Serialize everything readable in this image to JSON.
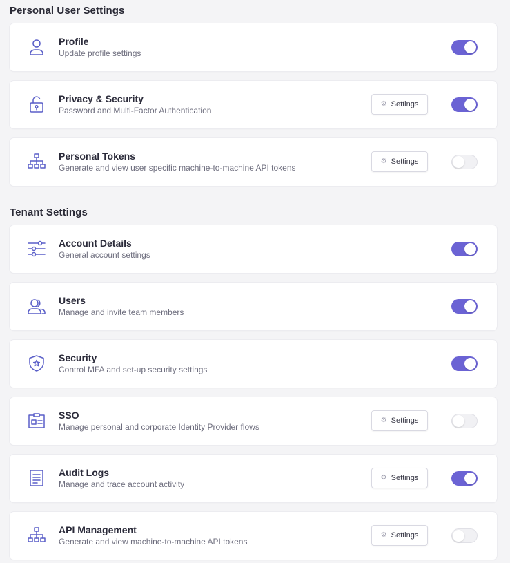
{
  "sections": [
    {
      "title": "Personal User Settings",
      "items": [
        {
          "id": "profile",
          "title": "Profile",
          "description": "Update profile settings",
          "icon": "user-icon",
          "has_settings": false,
          "enabled": true
        },
        {
          "id": "privacy-security",
          "title": "Privacy & Security",
          "description": "Password and Multi-Factor Authentication",
          "icon": "unlock-icon",
          "has_settings": true,
          "enabled": true
        },
        {
          "id": "personal-tokens",
          "title": "Personal Tokens",
          "description": "Generate and view user specific machine-to-machine API tokens",
          "icon": "network-icon",
          "has_settings": true,
          "enabled": false
        }
      ]
    },
    {
      "title": "Tenant Settings",
      "items": [
        {
          "id": "account-details",
          "title": "Account Details",
          "description": "General account settings",
          "icon": "sliders-icon",
          "has_settings": false,
          "enabled": true
        },
        {
          "id": "users",
          "title": "Users",
          "description": "Manage and invite team members",
          "icon": "users-icon",
          "has_settings": false,
          "enabled": true
        },
        {
          "id": "security",
          "title": "Security",
          "description": "Control MFA and set-up security settings",
          "icon": "shield-star-icon",
          "has_settings": false,
          "enabled": true
        },
        {
          "id": "sso",
          "title": "SSO",
          "description": "Manage personal and corporate Identity Provider flows",
          "icon": "id-card-icon",
          "has_settings": true,
          "enabled": false
        },
        {
          "id": "audit-logs",
          "title": "Audit Logs",
          "description": "Manage and trace account activity",
          "icon": "document-icon",
          "has_settings": true,
          "enabled": true
        },
        {
          "id": "api-management",
          "title": "API Management",
          "description": "Generate and view machine-to-machine API tokens",
          "icon": "network-icon",
          "has_settings": true,
          "enabled": false
        }
      ]
    }
  ],
  "settings_button_label": "Settings",
  "settings_button_icon": "gear-icon",
  "colors": {
    "accent": "#6b63d4",
    "icon": "#5a5fc8",
    "toggle_off": "#f1f1f4",
    "background": "#f4f4f6",
    "card": "#ffffff"
  }
}
